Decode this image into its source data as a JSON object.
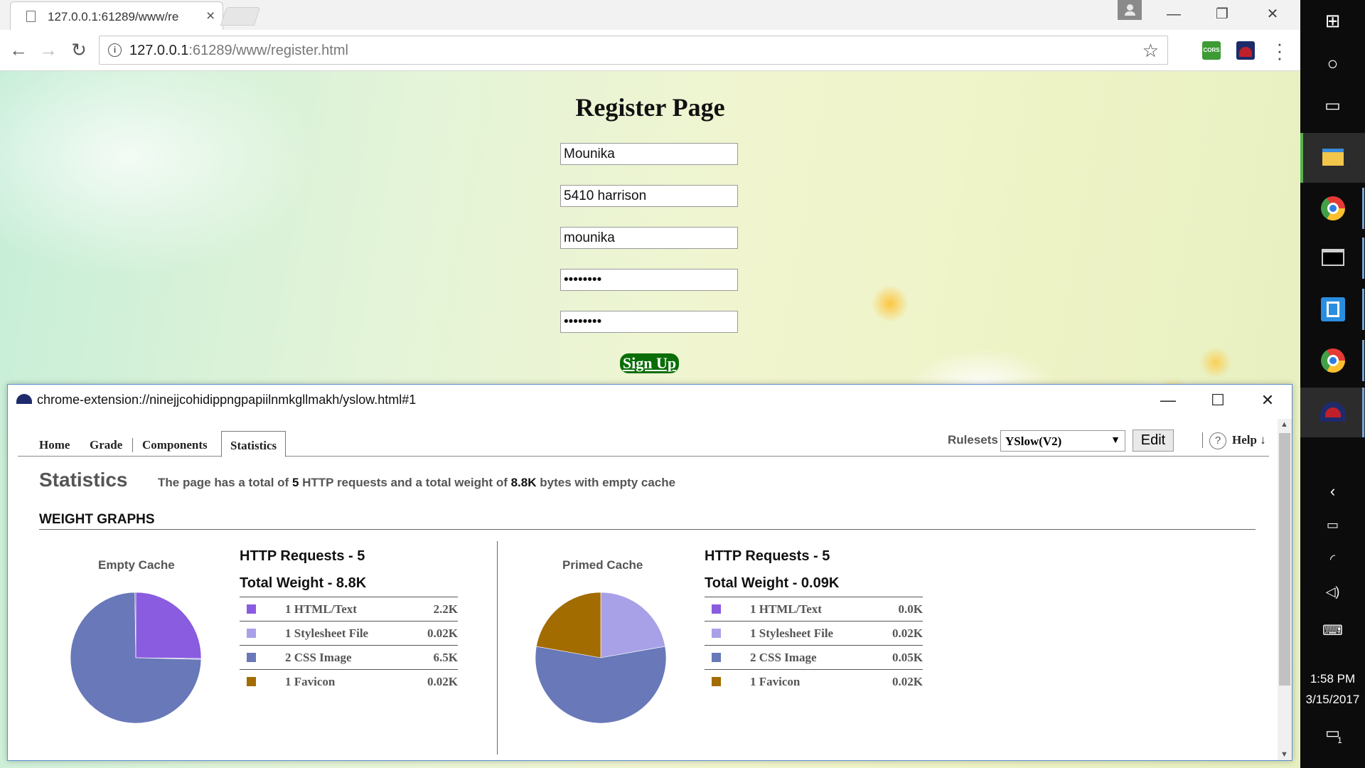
{
  "browser": {
    "tab_title": "127.0.0.1:61289/www/re",
    "tab_close": "×",
    "url_host": "127.0.0.1",
    "url_rest": ":61289/www/register.html",
    "cors_label": "CORS",
    "window_controls": {
      "minimize": "—",
      "restore": "❐",
      "close": "✕"
    },
    "nav": {
      "back": "←",
      "forward": "→",
      "reload": "↻"
    }
  },
  "page": {
    "title": "Register Page",
    "fields": [
      {
        "value": "Mounika"
      },
      {
        "value": "5410 harrison"
      },
      {
        "value": "mounika"
      },
      {
        "value": "••••••••"
      },
      {
        "value": "••••••••"
      }
    ],
    "signup_label": "Sign Up"
  },
  "yslow": {
    "window_url": "chrome-extension://ninejjcohidippngpapiilnmkgllmakh/yslow.html#1",
    "window_controls": {
      "minimize": "—",
      "maximize": "☐",
      "close": "✕"
    },
    "tabs": [
      "Home",
      "Grade",
      "Components",
      "Statistics"
    ],
    "active_tab": "Statistics",
    "rulesets_label": "Rulesets",
    "ruleset_selected": "YSlow(V2)",
    "edit_label": "Edit",
    "help_icon": "?",
    "help_label": "Help ↓",
    "stats_heading": "Statistics",
    "summary": {
      "prefix": "The page has a total of",
      "requests": "5",
      "middle": "HTTP requests and a total weight of",
      "weight": "8.8K",
      "suffix": "bytes with empty cache"
    },
    "weight_graphs_heading": "WEIGHT GRAPHS",
    "colors": {
      "html_text": "#8a5ce0",
      "stylesheet": "#a8a1e8",
      "css_image": "#6878b8",
      "favicon": "#a26c00"
    },
    "empty_cache": {
      "label": "Empty Cache",
      "requests_title": "HTTP Requests - 5",
      "weight_title": "Total Weight - 8.8K",
      "rows": [
        {
          "label": "1 HTML/Text",
          "value": "2.2K",
          "color": "#8a5ce0"
        },
        {
          "label": "1 Stylesheet File",
          "value": "0.02K",
          "color": "#a8a1e8"
        },
        {
          "label": "2 CSS Image",
          "value": "6.5K",
          "color": "#6878b8"
        },
        {
          "label": "1 Favicon",
          "value": "0.02K",
          "color": "#a26c00"
        }
      ]
    },
    "primed_cache": {
      "label": "Primed Cache",
      "requests_title": "HTTP Requests - 5",
      "weight_title": "Total Weight - 0.09K",
      "rows": [
        {
          "label": "1 HTML/Text",
          "value": "0.0K",
          "color": "#8a5ce0"
        },
        {
          "label": "1 Stylesheet File",
          "value": "0.02K",
          "color": "#a8a1e8"
        },
        {
          "label": "2 CSS Image",
          "value": "0.05K",
          "color": "#6878b8"
        },
        {
          "label": "1 Favicon",
          "value": "0.02K",
          "color": "#a26c00"
        }
      ]
    }
  },
  "taskbar": {
    "time": "1:58 PM",
    "date": "3/15/2017",
    "notification_count": "1"
  }
}
